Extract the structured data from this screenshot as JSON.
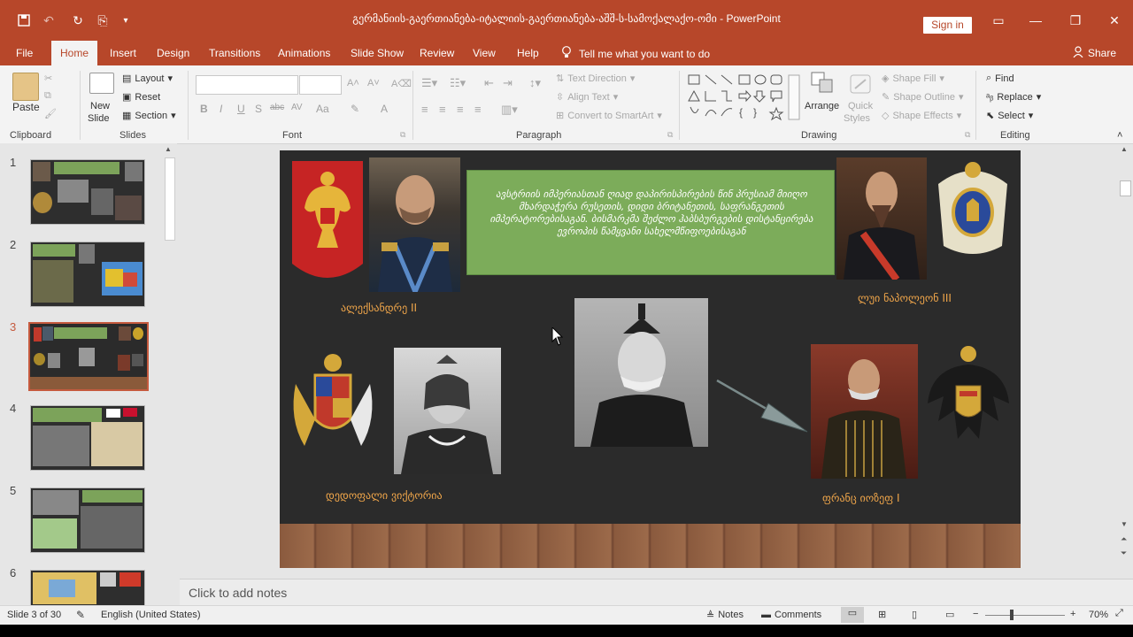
{
  "window": {
    "title": "გერმანიის-გაერთიანება-იტალიის-გაერთიანება-აშშ-ს-სამოქალაქო-ომი  -  PowerPoint",
    "sign_in": "Sign in",
    "accent": "#b7472a"
  },
  "ribbon_tabs": {
    "file": "File",
    "home": "Home",
    "insert": "Insert",
    "design": "Design",
    "transitions": "Transitions",
    "animations": "Animations",
    "slideshow": "Slide Show",
    "review": "Review",
    "view": "View",
    "help": "Help"
  },
  "tell_me": "Tell me what you want to do",
  "share": "Share",
  "groups": {
    "clipboard": "Clipboard",
    "slides": "Slides",
    "font": "Font",
    "paragraph": "Paragraph",
    "drawing": "Drawing",
    "editing": "Editing"
  },
  "buttons": {
    "paste": "Paste",
    "new_slide_1": "New",
    "new_slide_2": "Slide",
    "layout": "Layout",
    "reset": "Reset",
    "section": "Section",
    "text_direction": "Text Direction",
    "align_text": "Align Text",
    "convert_smartart": "Convert to SmartArt",
    "arrange": "Arrange",
    "quick_styles_1": "Quick",
    "quick_styles_2": "Styles",
    "shape_fill": "Shape Fill",
    "shape_outline": "Shape Outline",
    "shape_effects": "Shape Effects",
    "find": "Find",
    "replace": "Replace",
    "select": "Select"
  },
  "font_buttons": {
    "bold": "B",
    "italic": "I",
    "underline": "U",
    "shadow": "S",
    "strike": "abc",
    "spacing": "AV",
    "case": "Aa",
    "color": "A"
  },
  "thumbnails": [
    {
      "num": "1"
    },
    {
      "num": "2"
    },
    {
      "num": "3"
    },
    {
      "num": "4"
    },
    {
      "num": "5"
    },
    {
      "num": "6"
    }
  ],
  "slide": {
    "banner_text": "ავსტრიის იმპერიასთან ღიად დაპირისპირების წინ  პრუსიამ მიიღო მხარდაჭერა რუსეთის, დიდი ბრიტანეთის, საფრანგეთის იმპერატორებისაგან. ბისმარკმა შეძლო ჰაბსბურგების დისტანცირება ევროპის წამყვანი სახელმწიფოებისაგან",
    "captions": {
      "alexander": "ალექსანდრე II",
      "napoleon": "ლუი ნაპოლეონ III",
      "victoria": "დედოფალი ვიქტორია",
      "franz": "ფრანც იოზეფ I"
    }
  },
  "notes_placeholder": "Click to add notes",
  "status": {
    "slide_of": "Slide 3 of 30",
    "language": "English (United States)",
    "notes": "Notes",
    "comments": "Comments",
    "zoom": "70%"
  }
}
